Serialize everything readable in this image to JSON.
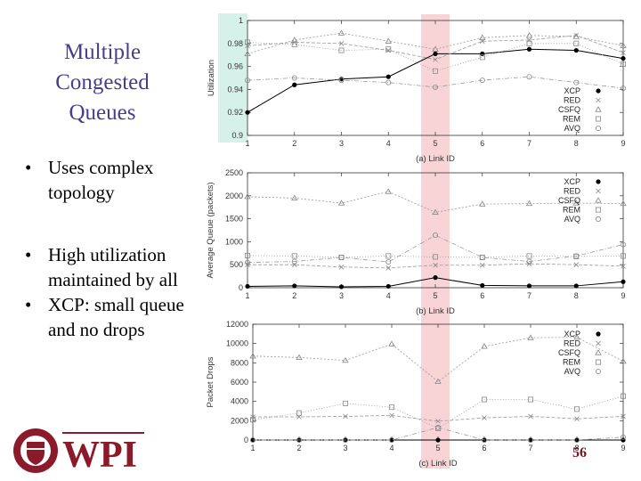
{
  "slide": {
    "title": "Multiple Congested Queues",
    "bullets_top": [
      "Uses complex topology"
    ],
    "bullets_bottom": [
      "High utilization maintained by all",
      "XCP: small queue and no drops"
    ],
    "page_number": "56",
    "logo_text": "WPI",
    "highlight_link": 5,
    "colors": {
      "title": "#4b3b8c",
      "highlight": "#f9d4d6",
      "axis_label_bg": "#d6f1ea",
      "logo": "#8b1a2b"
    }
  },
  "chart_data": [
    {
      "type": "line",
      "xlabel": "(a) Link ID",
      "ylabel": "Utilization",
      "x": [
        1,
        2,
        3,
        4,
        5,
        6,
        7,
        8,
        9
      ],
      "xlim": [
        1,
        9
      ],
      "ylim": [
        0.9,
        1
      ],
      "yticks": [
        "0.9",
        "0.92",
        "0.94",
        "0.96",
        "0.98",
        "1"
      ],
      "legend": "right",
      "series": [
        {
          "name": "XCP",
          "marker": "filled-circle",
          "values": [
            0.92,
            0.944,
            0.949,
            0.951,
            0.971,
            0.971,
            0.975,
            0.974,
            0.967
          ]
        },
        {
          "name": "RED",
          "marker": "x",
          "values": [
            0.978,
            0.981,
            0.98,
            0.974,
            0.966,
            0.982,
            0.983,
            0.987,
            0.972
          ]
        },
        {
          "name": "CSFQ",
          "marker": "triangle",
          "values": [
            0.971,
            0.983,
            0.989,
            0.982,
            0.975,
            0.985,
            0.987,
            0.986,
            0.978
          ]
        },
        {
          "name": "REM",
          "marker": "square",
          "values": [
            0.981,
            0.979,
            0.974,
            0.975,
            0.956,
            0.968,
            0.98,
            0.98,
            0.962
          ]
        },
        {
          "name": "AVQ",
          "marker": "circle",
          "values": [
            0.948,
            0.95,
            0.948,
            0.946,
            0.942,
            0.948,
            0.951,
            0.946,
            0.941
          ]
        }
      ]
    },
    {
      "type": "line",
      "xlabel": "(b) Link ID",
      "ylabel": "Average Queue (packets)",
      "x": [
        1,
        2,
        3,
        4,
        5,
        6,
        7,
        8,
        9
      ],
      "xlim": [
        1,
        9
      ],
      "ylim": [
        0,
        2500
      ],
      "yticks": [
        "0",
        "500",
        "1000",
        "1500",
        "2000",
        "2500"
      ],
      "legend": "top-right",
      "series": [
        {
          "name": "XCP",
          "marker": "filled-circle",
          "values": [
            30,
            40,
            20,
            30,
            220,
            50,
            40,
            40,
            130
          ]
        },
        {
          "name": "RED",
          "marker": "x",
          "values": [
            500,
            500,
            450,
            430,
            490,
            490,
            520,
            500,
            470
          ]
        },
        {
          "name": "CSFQ",
          "marker": "triangle",
          "values": [
            1980,
            1950,
            1840,
            2090,
            1640,
            1820,
            1830,
            1840,
            1830
          ]
        },
        {
          "name": "REM",
          "marker": "square",
          "values": [
            700,
            690,
            660,
            690,
            670,
            660,
            690,
            680,
            690
          ]
        },
        {
          "name": "AVQ",
          "marker": "circle",
          "values": [
            550,
            570,
            660,
            560,
            1140,
            660,
            570,
            690,
            940
          ]
        }
      ]
    },
    {
      "type": "line",
      "xlabel": "(c) Link ID",
      "ylabel": "Packet Drops",
      "x": [
        1,
        2,
        3,
        4,
        5,
        6,
        7,
        8,
        9
      ],
      "xlim": [
        1,
        9
      ],
      "ylim": [
        0,
        12000
      ],
      "yticks": [
        "0",
        "2000",
        "4000",
        "6000",
        "8000",
        "10000",
        "12000"
      ],
      "legend": "top-right",
      "series": [
        {
          "name": "XCP",
          "marker": "filled-circle",
          "values": [
            0,
            0,
            0,
            0,
            0,
            0,
            0,
            0,
            0
          ]
        },
        {
          "name": "RED",
          "marker": "x",
          "values": [
            2400,
            2400,
            2450,
            2550,
            1950,
            2300,
            2450,
            2200,
            2450
          ]
        },
        {
          "name": "CSFQ",
          "marker": "triangle",
          "values": [
            8700,
            8550,
            8250,
            9950,
            6050,
            9700,
            10600,
            10650,
            8150
          ]
        },
        {
          "name": "REM",
          "marker": "square",
          "values": [
            2100,
            2800,
            3800,
            3400,
            1200,
            4200,
            4200,
            3200,
            4550
          ]
        },
        {
          "name": "AVQ",
          "marker": "circle",
          "values": [
            0,
            0,
            0,
            0,
            1300,
            0,
            0,
            0,
            300
          ]
        }
      ]
    }
  ]
}
